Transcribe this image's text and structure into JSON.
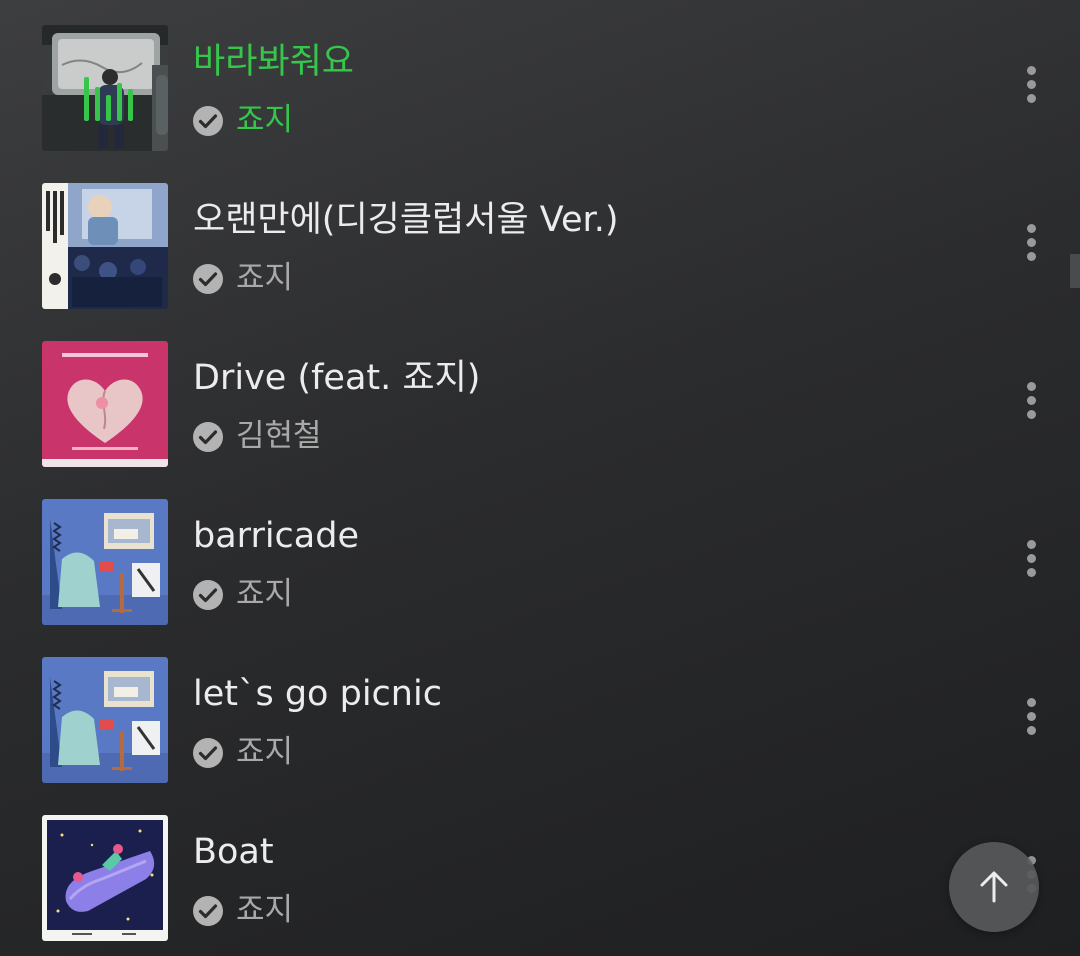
{
  "tracks": [
    {
      "title": "바라봐줘요",
      "artist": "죠지",
      "playing": true
    },
    {
      "title": "오랜만에(디깅클럽서울 Ver.)",
      "artist": "죠지",
      "playing": false
    },
    {
      "title": "Drive (feat. 죠지)",
      "artist": "김현철",
      "playing": false
    },
    {
      "title": "barricade",
      "artist": "죠지",
      "playing": false
    },
    {
      "title": "let`s go picnic",
      "artist": "죠지",
      "playing": false
    },
    {
      "title": "Boat",
      "artist": "죠지",
      "playing": false
    }
  ],
  "icons": {
    "verified": "check-circle-icon",
    "more": "more-vertical-icon",
    "scroll_top": "arrow-up-icon",
    "now_playing": "equalizer-icon"
  },
  "colors": {
    "playing_accent": "#35c64a",
    "title": "#ececec",
    "artist": "#a9a9a9",
    "background": "#2b2c2e"
  }
}
